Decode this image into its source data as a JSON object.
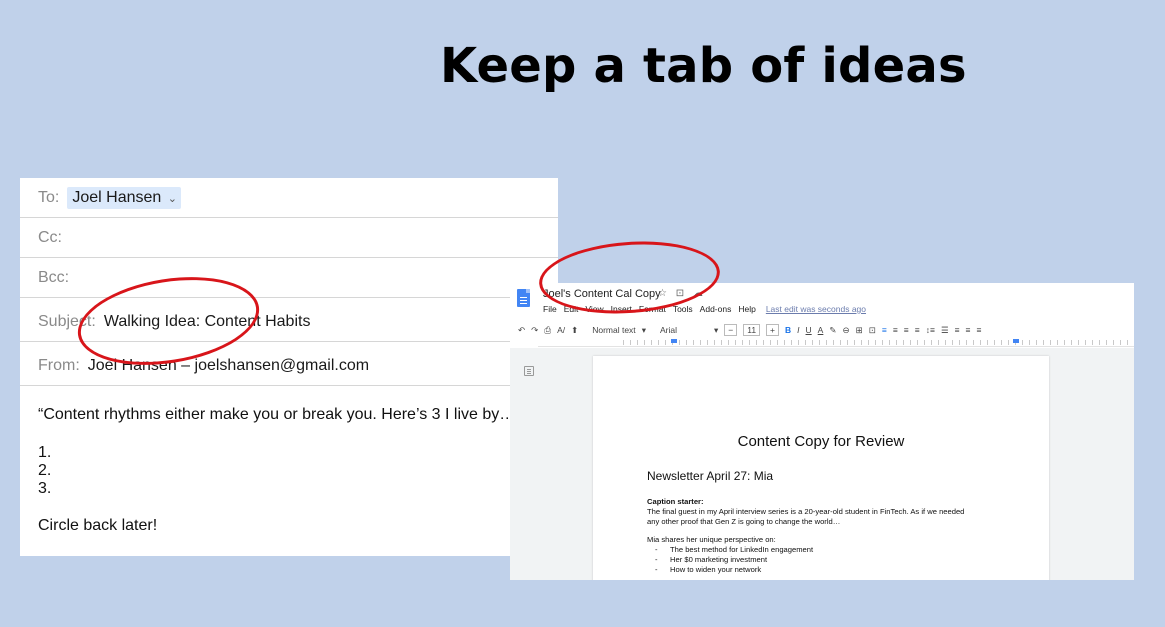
{
  "slide": {
    "title": "Keep a tab of ideas"
  },
  "email": {
    "to_label": "To:",
    "to_value": "Joel Hansen",
    "to_chevron": "⌄",
    "cc_label": "Cc:",
    "bcc_label": "Bcc:",
    "subject_label": "Subject:",
    "subject_value": "Walking Idea: Content Habits",
    "from_label": "From:",
    "from_value": "Joel Hansen – joelshansen@gmail.com",
    "body_quote": "“Content rhythms either make you or break you. Here’s 3 I live by….”",
    "body_list": [
      "1.",
      "2.",
      "3."
    ],
    "body_closing": "Circle back later!"
  },
  "docs": {
    "title": "Joel's Content Cal Copy",
    "title_icons": "☆ ⊡ ☁",
    "menu": [
      "File",
      "Edit",
      "View",
      "Insert",
      "Format",
      "Tools",
      "Add-ons",
      "Help"
    ],
    "last_edit": "Last edit was seconds ago",
    "toolbar": {
      "undo": "↶",
      "redo": "↷",
      "print": "⎙",
      "spell": "A/",
      "paint": "⬆",
      "style_select": "Normal text",
      "style_caret": "▾",
      "font_select": "Arial",
      "font_caret": "▾",
      "size_minus": "−",
      "font_size": "11",
      "size_plus": "+",
      "bold": "B",
      "italic": "I",
      "underline": "U",
      "text_color": "A",
      "highlight": "✎",
      "link": "⊖",
      "comment": "⊞",
      "image": "⊡",
      "align_left": "≡",
      "align_center": "≡",
      "align_right": "≡",
      "align_justify": "≡",
      "line_spacing": "↕≡",
      "checklist": "☰",
      "bullets": "≡",
      "numbered": "≡",
      "more": "≡"
    },
    "page": {
      "heading": "Content Copy for Review",
      "subheading": "Newsletter April 27: Mia",
      "caption_label": "Caption starter:",
      "caption_lines": [
        "The final guest in my April interview series is a 20-year-old student in FinTech. As if we needed",
        "any other proof that Gen Z is going to change the world…"
      ],
      "mia_intro": "Mia shares her unique perspective on:",
      "bullets": [
        "The best method for LinkedIn engagement",
        "Her $0 marketing investment",
        "How to widen your network"
      ]
    }
  },
  "annotations": {
    "circle_color": "#d8151a"
  }
}
